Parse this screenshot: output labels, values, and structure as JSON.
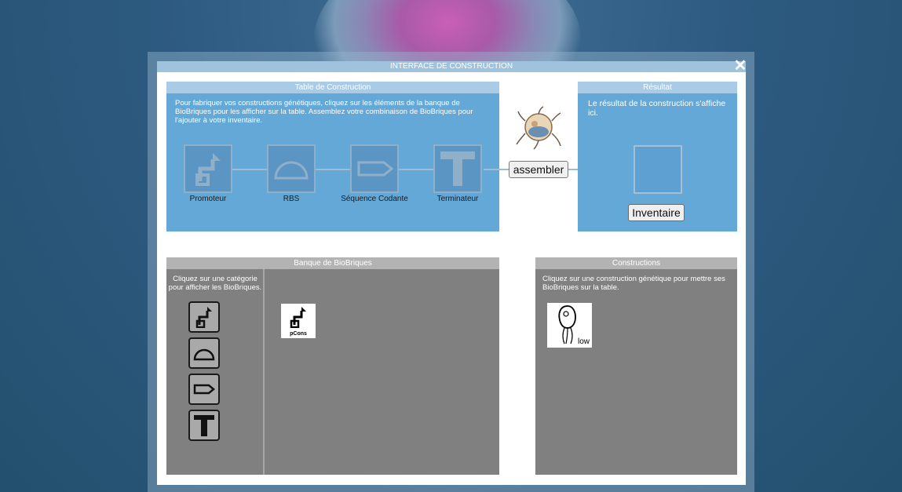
{
  "modal": {
    "title": "INTERFACE DE CONSTRUCTION",
    "close_label": "✕"
  },
  "construction_table": {
    "title": "Table de Construction",
    "instructions": "Pour fabriquer vos constructions génétiques, cliquez sur les éléments de la banque de BioBriques pour les afficher sur la table. Assemblez votre combinaison de BioBriques pour l'ajouter à votre inventaire.",
    "slots": [
      {
        "label": "Promoteur",
        "icon": "promoter-icon"
      },
      {
        "label": "RBS",
        "icon": "rbs-icon"
      },
      {
        "label": "Séquence Codante",
        "icon": "coding-sequence-icon"
      },
      {
        "label": "Terminateur",
        "icon": "terminator-icon"
      }
    ]
  },
  "assemble": {
    "label": "assembler",
    "icon": "bacteriophage-icon"
  },
  "result": {
    "title": "Résultat",
    "text": "Le résultat de la construction s'affiche ici.",
    "inventory_label": "Inventaire"
  },
  "biobrick_bank": {
    "title": "Banque de BioBriques",
    "instructions": "Cliquez sur une catégorie pour afficher les BioBriques.",
    "categories": [
      "promoter-icon",
      "rbs-icon",
      "coding-sequence-icon",
      "terminator-icon"
    ],
    "bricks": [
      {
        "label": "pCons",
        "icon": "promoter-icon"
      }
    ]
  },
  "constructions": {
    "title": "Constructions",
    "instructions": "Cliquez sur une construction génétique pour mettre ses BioBriques sur la table.",
    "items": [
      {
        "label": "low",
        "icon": "bacterium-icon"
      }
    ]
  }
}
